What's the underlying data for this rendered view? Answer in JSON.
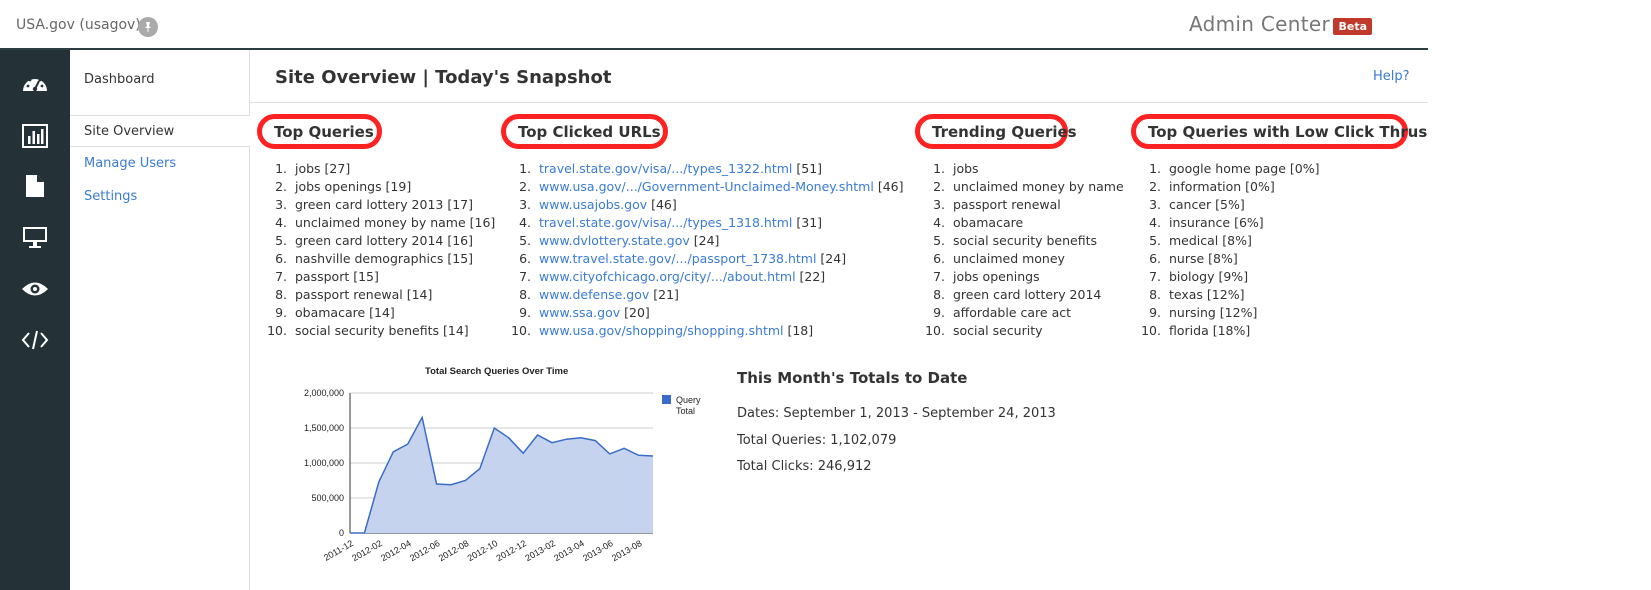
{
  "header": {
    "site_name": "USA.gov (usagov)",
    "app_title": "Admin Center",
    "beta_label": "Beta"
  },
  "icon_rail": [
    {
      "icon": "dashboard-gauge-icon"
    },
    {
      "icon": "bar-chart-icon"
    },
    {
      "icon": "document-icon"
    },
    {
      "icon": "monitor-icon"
    },
    {
      "icon": "eye-icon"
    },
    {
      "icon": "code-icon"
    }
  ],
  "nav": {
    "dashboard": "Dashboard",
    "site_overview": "Site Overview",
    "manage_users": "Manage Users",
    "settings": "Settings"
  },
  "page": {
    "title": "Site Overview | Today's Snapshot",
    "help": "Help?"
  },
  "sections": {
    "top_queries": {
      "heading": "Top Queries",
      "items": [
        "jobs [27]",
        "jobs openings [19]",
        "green card lottery 2013 [17]",
        "unclaimed money by name [16]",
        "green card lottery 2014 [16]",
        "nashville demographics [15]",
        "passport [15]",
        "passport renewal [14]",
        "obamacare [14]",
        "social security benefits [14]"
      ]
    },
    "top_clicked_urls": {
      "heading": "Top Clicked URLs",
      "items": [
        {
          "url": "travel.state.gov/visa/.../types_1322.html",
          "count": "[51]"
        },
        {
          "url": "www.usa.gov/.../Government-Unclaimed-Money.shtml",
          "count": "[46]"
        },
        {
          "url": "www.usajobs.gov",
          "count": "[46]"
        },
        {
          "url": "travel.state.gov/visa/.../types_1318.html",
          "count": "[31]"
        },
        {
          "url": "www.dvlottery.state.gov",
          "count": "[24]"
        },
        {
          "url": "www.travel.state.gov/.../passport_1738.html",
          "count": "[24]"
        },
        {
          "url": "www.cityofchicago.org/city/.../about.html",
          "count": "[22]"
        },
        {
          "url": "www.defense.gov",
          "count": "[21]"
        },
        {
          "url": "www.ssa.gov",
          "count": "[20]"
        },
        {
          "url": "www.usa.gov/shopping/shopping.shtml",
          "count": "[18]"
        }
      ]
    },
    "trending_queries": {
      "heading": "Trending Queries",
      "items": [
        "jobs",
        "unclaimed money by name",
        "passport renewal",
        "obamacare",
        "social security benefits",
        "unclaimed money",
        "jobs openings",
        "green card lottery 2014",
        "affordable care act",
        "social security"
      ]
    },
    "low_click_thrus": {
      "heading": "Top Queries with Low Click Thrus",
      "items": [
        "google home page [0%]",
        "information [0%]",
        "cancer [5%]",
        "insurance [6%]",
        "medical [8%]",
        "nurse [8%]",
        "biology [9%]",
        "texas [12%]",
        "nursing [12%]",
        "florida [18%]"
      ]
    }
  },
  "totals": {
    "title": "This Month's Totals to Date",
    "dates": "Dates: September 1, 2013 - September 24, 2013",
    "queries": "Total Queries: 1,102,079",
    "clicks": "Total Clicks: 246,912"
  },
  "colors": {
    "rail_bg": "#243238",
    "link": "#3a7bd5",
    "highlight_ring": "#ff2222",
    "series_fill": "#c5d3ee",
    "series_line": "#3a6cc7",
    "beta_bg": "#c0392b"
  },
  "chart_data": {
    "type": "area",
    "title": "Total Search Queries Over Time",
    "xlabel": "",
    "ylabel": "",
    "ylim": [
      0,
      2000000
    ],
    "y_ticks": [
      "2,000,000",
      "1,500,000",
      "1,000,000",
      "500,000",
      "0"
    ],
    "x_tick_labels": [
      "2011-12",
      "2012-02",
      "2012-04",
      "2012-06",
      "2012-08",
      "2012-10",
      "2012-12",
      "2013-02",
      "2013-04",
      "2013-06",
      "2013-08"
    ],
    "grid": true,
    "legend": "right",
    "series": [
      {
        "name": "Query Total",
        "x": [
          "2011-12",
          "2012-01",
          "2012-02",
          "2012-03",
          "2012-04",
          "2012-05",
          "2012-06",
          "2012-07",
          "2012-08",
          "2012-09",
          "2012-10",
          "2012-11",
          "2012-12",
          "2013-01",
          "2013-02",
          "2013-03",
          "2013-04",
          "2013-05",
          "2013-06",
          "2013-07",
          "2013-08",
          "2013-09"
        ],
        "values": [
          0,
          0,
          730000,
          1160000,
          1270000,
          1650000,
          700000,
          690000,
          750000,
          920000,
          1500000,
          1360000,
          1140000,
          1400000,
          1290000,
          1340000,
          1360000,
          1320000,
          1130000,
          1210000,
          1110000,
          1100000
        ]
      }
    ]
  }
}
